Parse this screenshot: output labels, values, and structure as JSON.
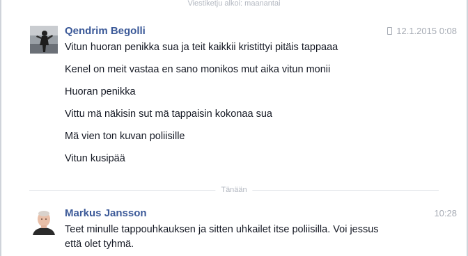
{
  "thread": {
    "start_label": "Viestiketju alkoi: maanantai",
    "today_label": "Tänään"
  },
  "messages": [
    {
      "sender": "Qendrim Begolli",
      "timestamp": "12.1.2015 0:08",
      "via_mobile": true,
      "lines": [
        "Vitun huoran penikka sua ja teit kaikkii kristittyi pitäis tappaaa",
        "Kenel on meit vastaa en sano monikos mut aika vitun monii",
        "Huoran penikka",
        "Vittu mä näkisin sut mä tappaisin kokonaa sua",
        "Mä vien ton kuvan poliisille",
        "Vitun kusipää"
      ]
    },
    {
      "sender": "Markus Jansson",
      "timestamp": "10:28",
      "via_mobile": false,
      "lines": [
        "Teet minulle tappouhkauksen ja sitten uhkailet itse poliisilla. Voi jessus",
        "että olet tyhmä."
      ]
    }
  ],
  "colors": {
    "sender_name": "#3b5998",
    "body_text": "#141823",
    "meta_text": "#a6abb4"
  }
}
